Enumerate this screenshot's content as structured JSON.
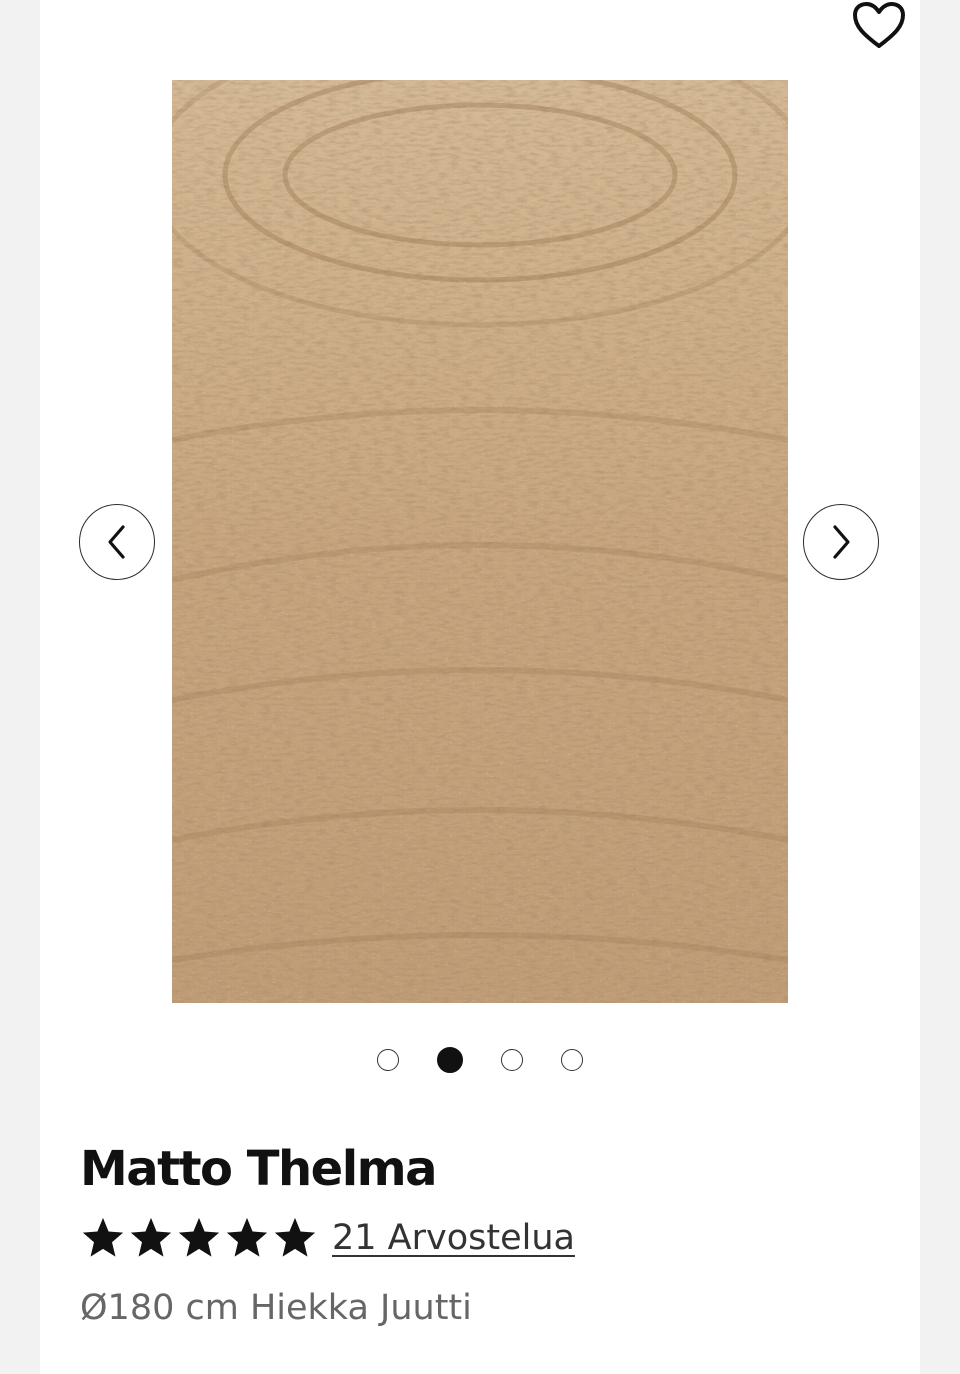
{
  "icons": {
    "favorite": "heart-outline-icon",
    "prev": "chevron-left-icon",
    "next": "chevron-right-icon",
    "star": "star-filled-icon"
  },
  "gallery": {
    "image_alt": "Matto Thelma",
    "slide_count": 4,
    "active_slide": 2
  },
  "product": {
    "title": "Matto Thelma",
    "rating": 5,
    "rating_max": 5,
    "reviews_label": "21 Arvostelua",
    "variant": "Ø180 cm Hiekka Juutti"
  },
  "colors": {
    "jute": "#c9a883",
    "jute_dark": "#9c7a55",
    "text": "#111111",
    "muted": "#666666"
  }
}
